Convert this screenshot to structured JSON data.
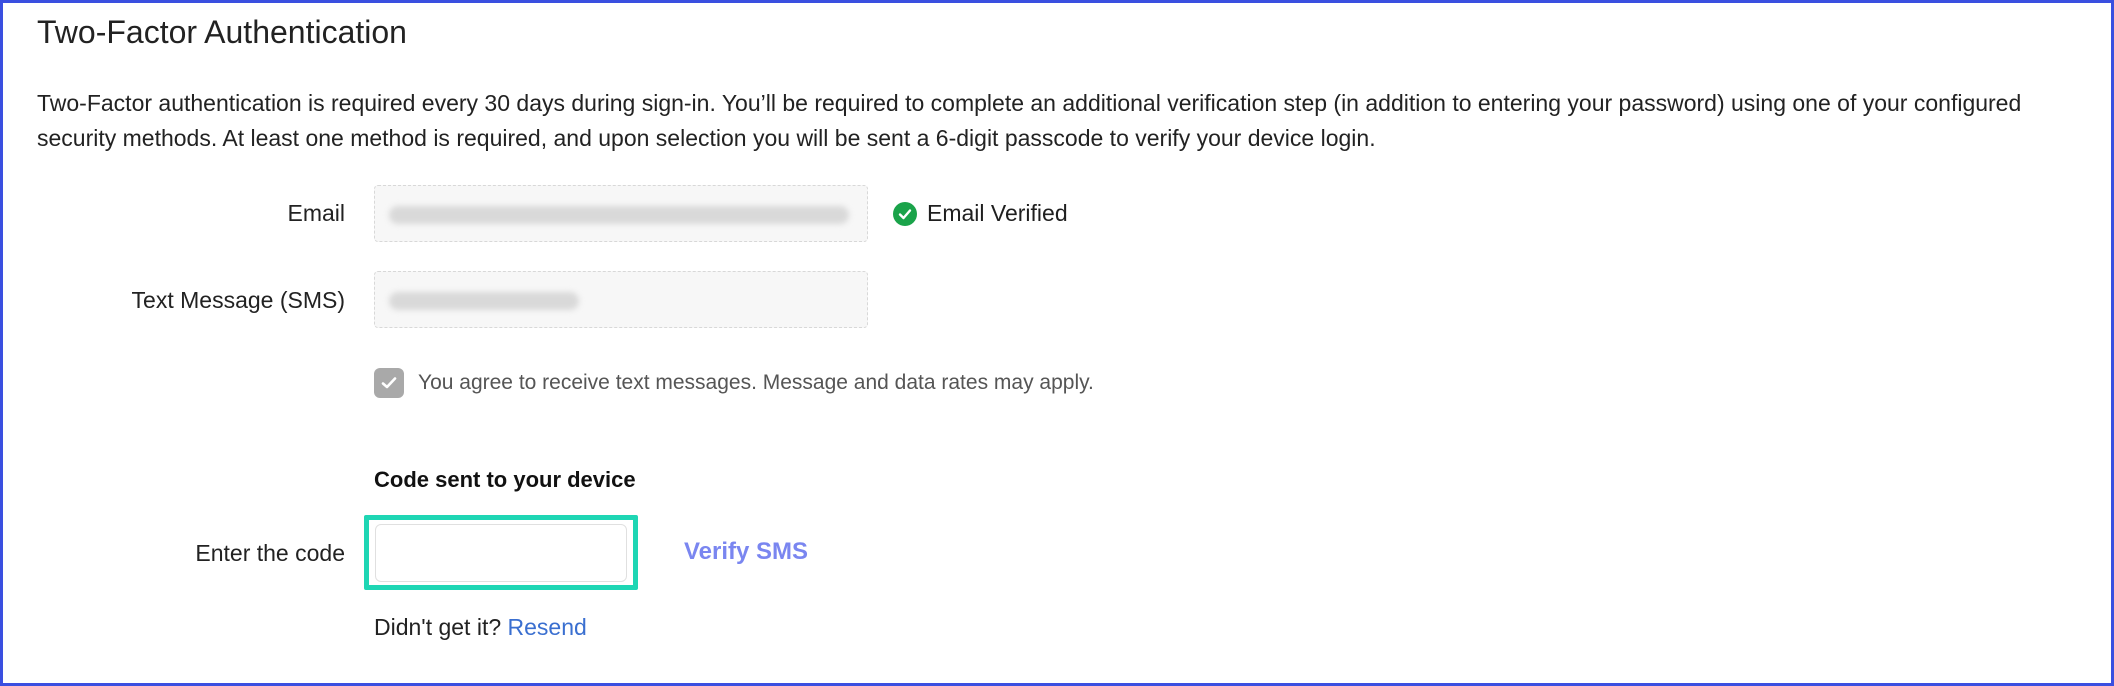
{
  "section": {
    "title": "Two-Factor Authentication",
    "description": "Two-Factor authentication is required every 30 days during sign-in. You’ll be required to complete an additional verification step (in addition to entering your password) using one of your configured security methods. At least one method is required, and upon selection you will be sent a 6-digit passcode to verify your device login."
  },
  "email": {
    "label": "Email",
    "value": "",
    "status": "Email Verified",
    "status_icon": "check-circle-icon",
    "status_color": "#1aa34a"
  },
  "sms": {
    "label": "Text Message (SMS)",
    "value": ""
  },
  "consent": {
    "checked": true,
    "text": "You agree to receive text messages. Message and data rates may apply."
  },
  "verification": {
    "heading": "Code sent to your device",
    "code_label": "Enter the code",
    "code_value": "",
    "verify_label": "Verify SMS",
    "didnt_get": "Didn't get it?",
    "resend_label": "Resend"
  },
  "colors": {
    "highlight": "#1ed6b4",
    "link": "#3a6fd0",
    "verify": "#7a86f0",
    "frame": "#3a4fe0"
  }
}
